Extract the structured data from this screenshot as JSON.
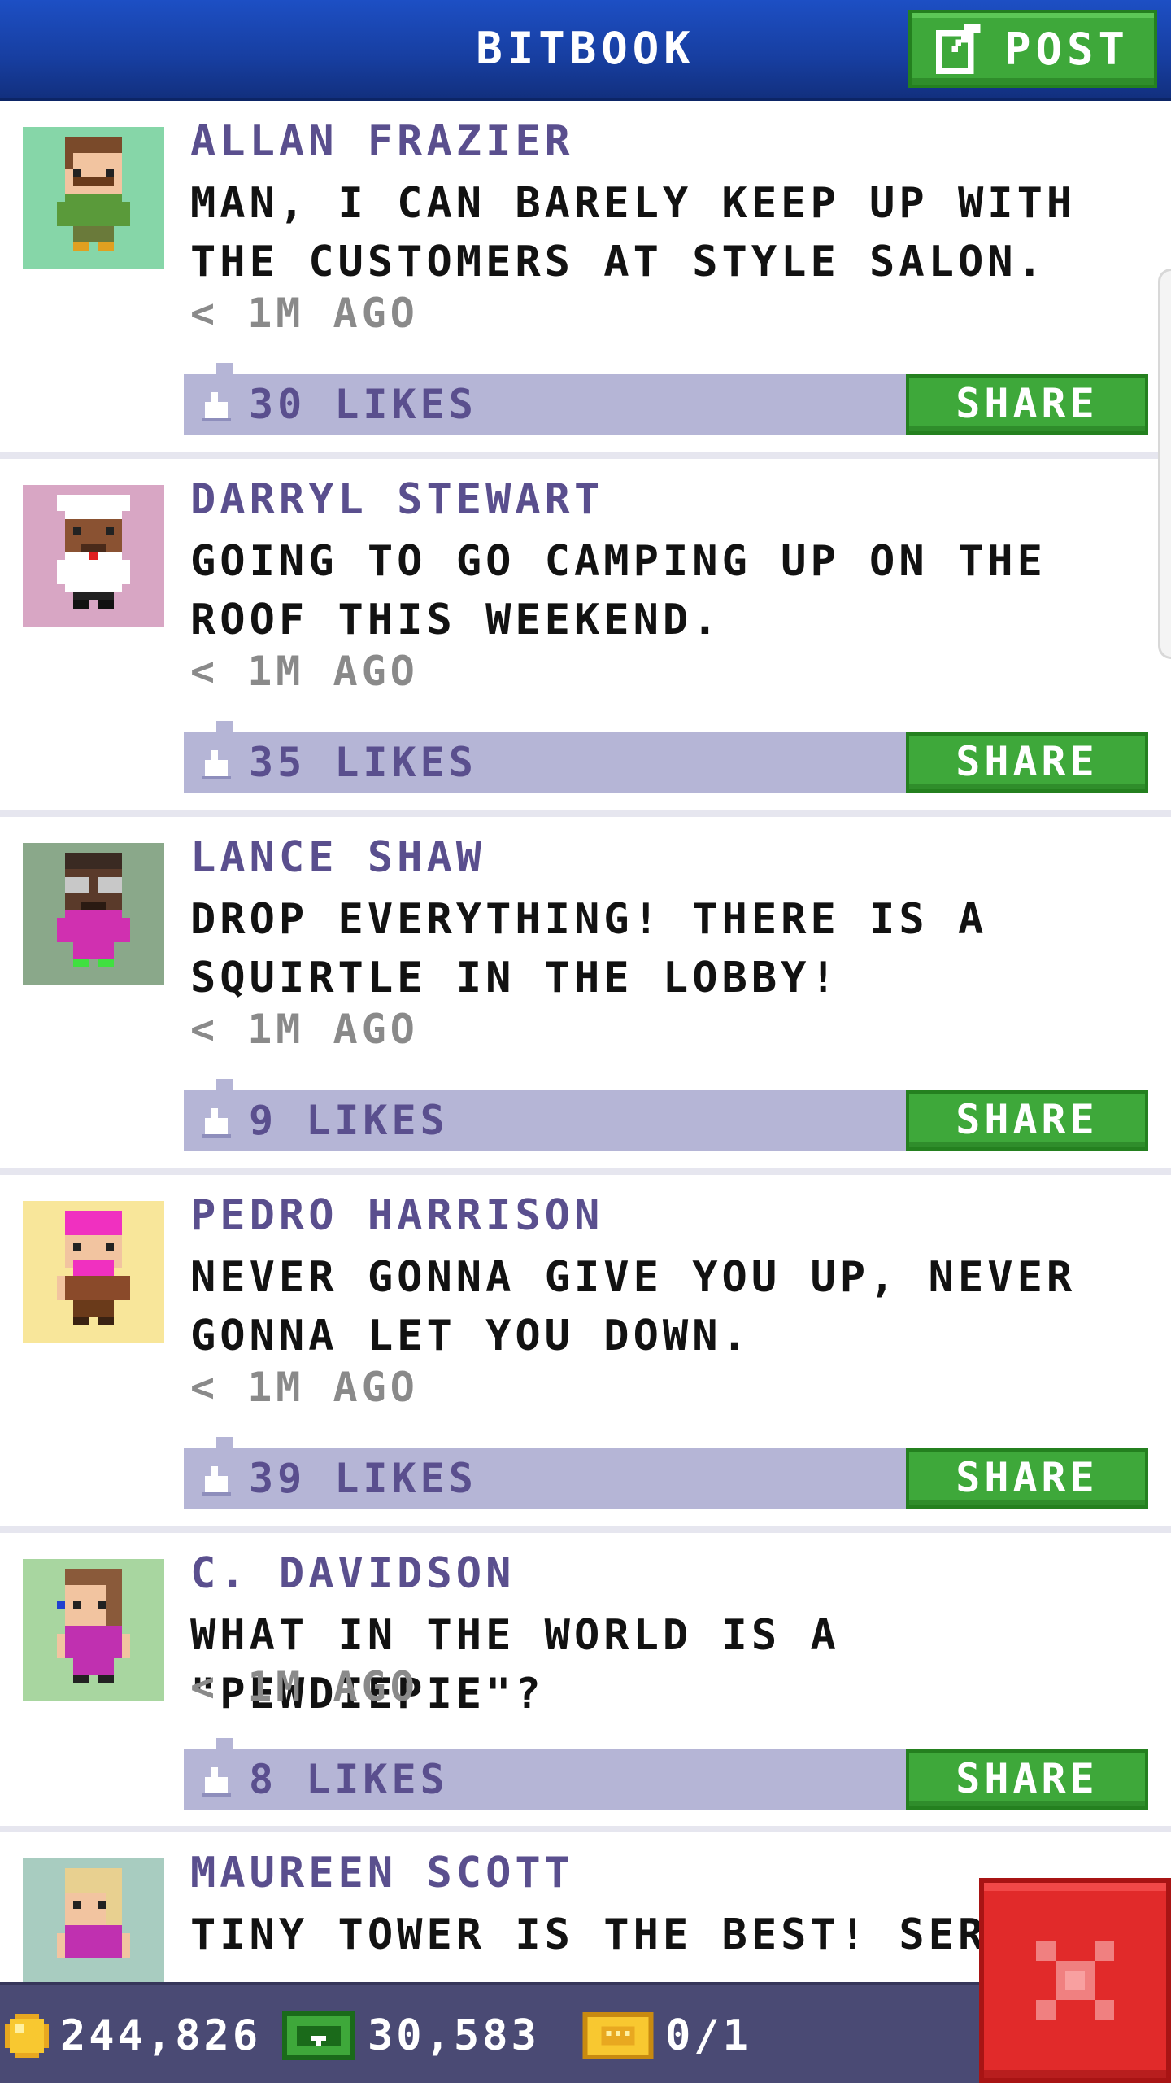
{
  "header": {
    "title": "BITBOOK",
    "post_label": "POST"
  },
  "posts": [
    {
      "author": "ALLAN FRAZIER",
      "message": "MAN, I CAN BARELY KEEP UP WITH THE CUSTOMERS AT STYLE SALON.",
      "time": "< 1M AGO",
      "likes": "30 LIKES",
      "share": "SHARE",
      "avatar_bg": "#86d6a8"
    },
    {
      "author": "DARRYL STEWART",
      "message": "GOING TO GO CAMPING UP ON THE ROOF THIS WEEKEND.",
      "time": "< 1M AGO",
      "likes": "35 LIKES",
      "share": "SHARE",
      "avatar_bg": "#d8a6c4"
    },
    {
      "author": "LANCE SHAW",
      "message": "DROP EVERYTHING! THERE IS A SQUIRTLE IN THE LOBBY!",
      "time": "< 1M AGO",
      "likes": "9 LIKES",
      "share": "SHARE",
      "avatar_bg": "#8aa88a"
    },
    {
      "author": "PEDRO HARRISON",
      "message": "NEVER GONNA GIVE YOU UP, NEVER GONNA LET YOU DOWN.",
      "time": "< 1M AGO",
      "likes": "39 LIKES",
      "share": "SHARE",
      "avatar_bg": "#f8e69a"
    },
    {
      "author": "C. DAVIDSON",
      "message": "WHAT IN THE WORLD IS A \"PEWDIEPIE\"?",
      "time": "< 1M AGO",
      "likes": "8 LIKES",
      "share": "SHARE",
      "avatar_bg": "#a8d6a0"
    },
    {
      "author": "MAUREEN SCOTT",
      "message": "TINY TOWER IS THE BEST! SERIOU",
      "time": "",
      "likes": "",
      "share": "",
      "avatar_bg": "#a8ccc0"
    }
  ],
  "bottom_bar": {
    "coins": "244,826",
    "bux": "30,583",
    "tickets": "0/1"
  },
  "colors": {
    "header_blue": "#1d4fc4",
    "accent_green": "#3ea83a",
    "likes_bar": "#b5b5d6",
    "author_purple": "#5a4f8e",
    "close_red": "#e12a2a"
  },
  "icons": {
    "post": "edit-icon",
    "like": "thumbs-up-icon",
    "coin": "coin-icon",
    "bux": "bux-icon",
    "ticket": "ticket-icon",
    "close": "close-icon"
  }
}
